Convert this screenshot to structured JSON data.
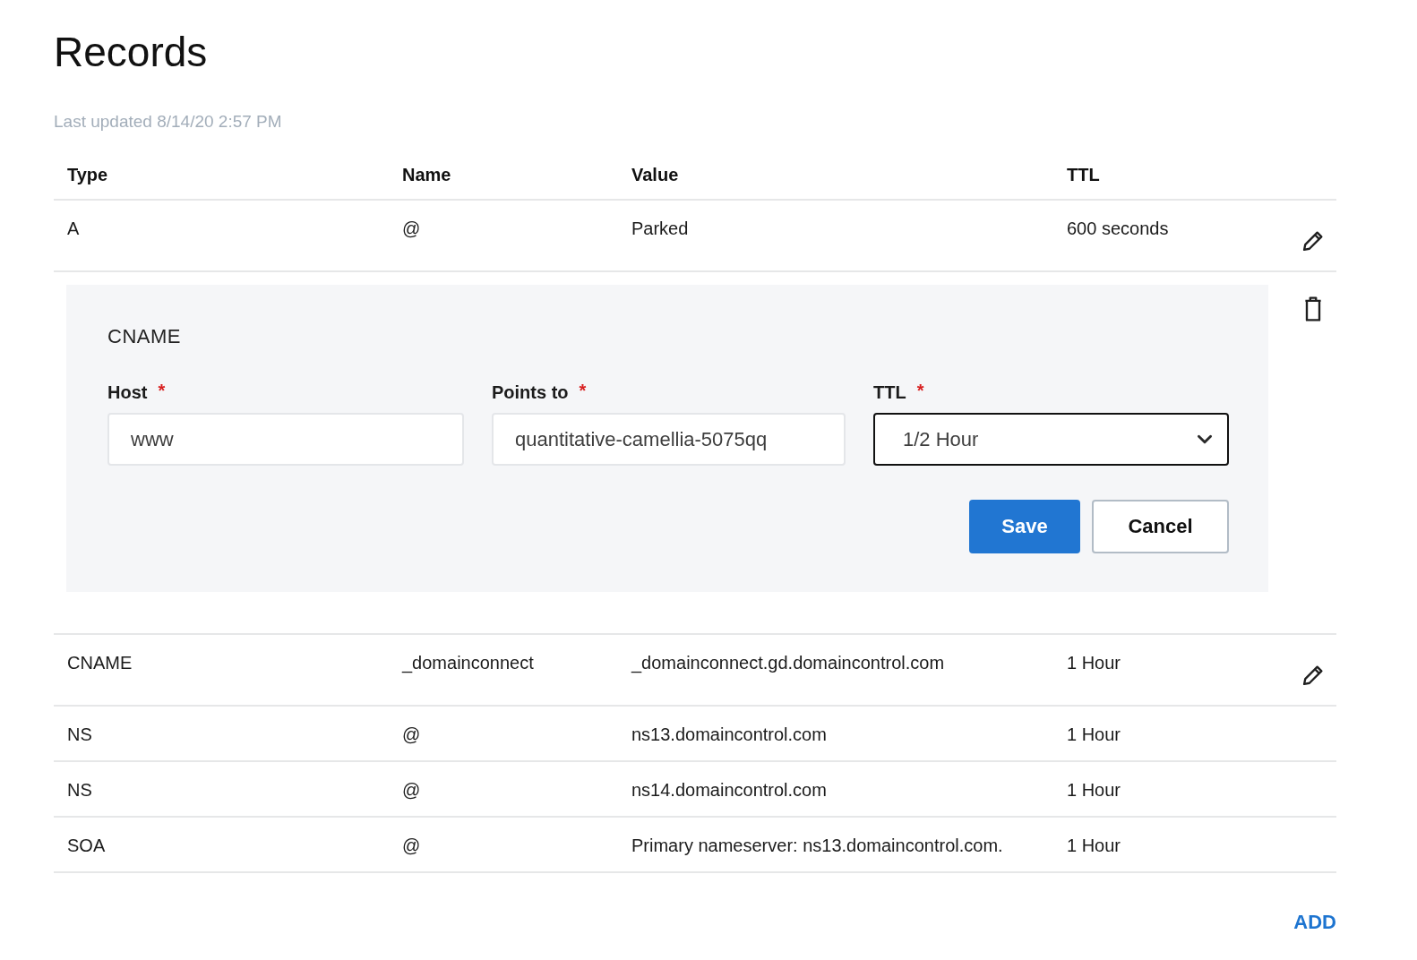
{
  "page": {
    "title": "Records",
    "last_updated": "Last updated 8/14/20 2:57 PM"
  },
  "table": {
    "columns": [
      "Type",
      "Name",
      "Value",
      "TTL"
    ],
    "rows": [
      {
        "kind": "record",
        "type": "A",
        "name": "@",
        "value": "Parked",
        "ttl": "600 seconds",
        "editable": true
      },
      {
        "kind": "editor",
        "record_type": "CNAME",
        "deletable": true,
        "fields": [
          {
            "kind": "text",
            "label": "Host",
            "required_mark": "*",
            "value": "www",
            "focused": false
          },
          {
            "kind": "text",
            "label": "Points to",
            "required_mark": "*",
            "value": "quantitative-camellia-5075qq",
            "focused": false
          },
          {
            "kind": "select",
            "label": "TTL",
            "required_mark": "*",
            "value": "1/2 Hour",
            "focused": true
          }
        ],
        "buttons": [
          {
            "kind": "primary",
            "label": "Save"
          },
          {
            "kind": "secondary",
            "label": "Cancel"
          }
        ]
      },
      {
        "kind": "record",
        "type": "CNAME",
        "name": "_domainconnect",
        "value": "_domainconnect.gd.domaincontrol.com",
        "ttl": "1 Hour",
        "editable": true
      },
      {
        "kind": "record",
        "type": "NS",
        "name": "@",
        "value": "ns13.domaincontrol.com",
        "ttl": "1 Hour",
        "editable": false
      },
      {
        "kind": "record",
        "type": "NS",
        "name": "@",
        "value": "ns14.domaincontrol.com",
        "ttl": "1 Hour",
        "editable": false
      },
      {
        "kind": "record",
        "type": "SOA",
        "name": "@",
        "value": "Primary nameserver: ns13.domaincontrol.com.",
        "ttl": "1 Hour",
        "editable": false
      }
    ]
  },
  "add_link": "ADD"
}
